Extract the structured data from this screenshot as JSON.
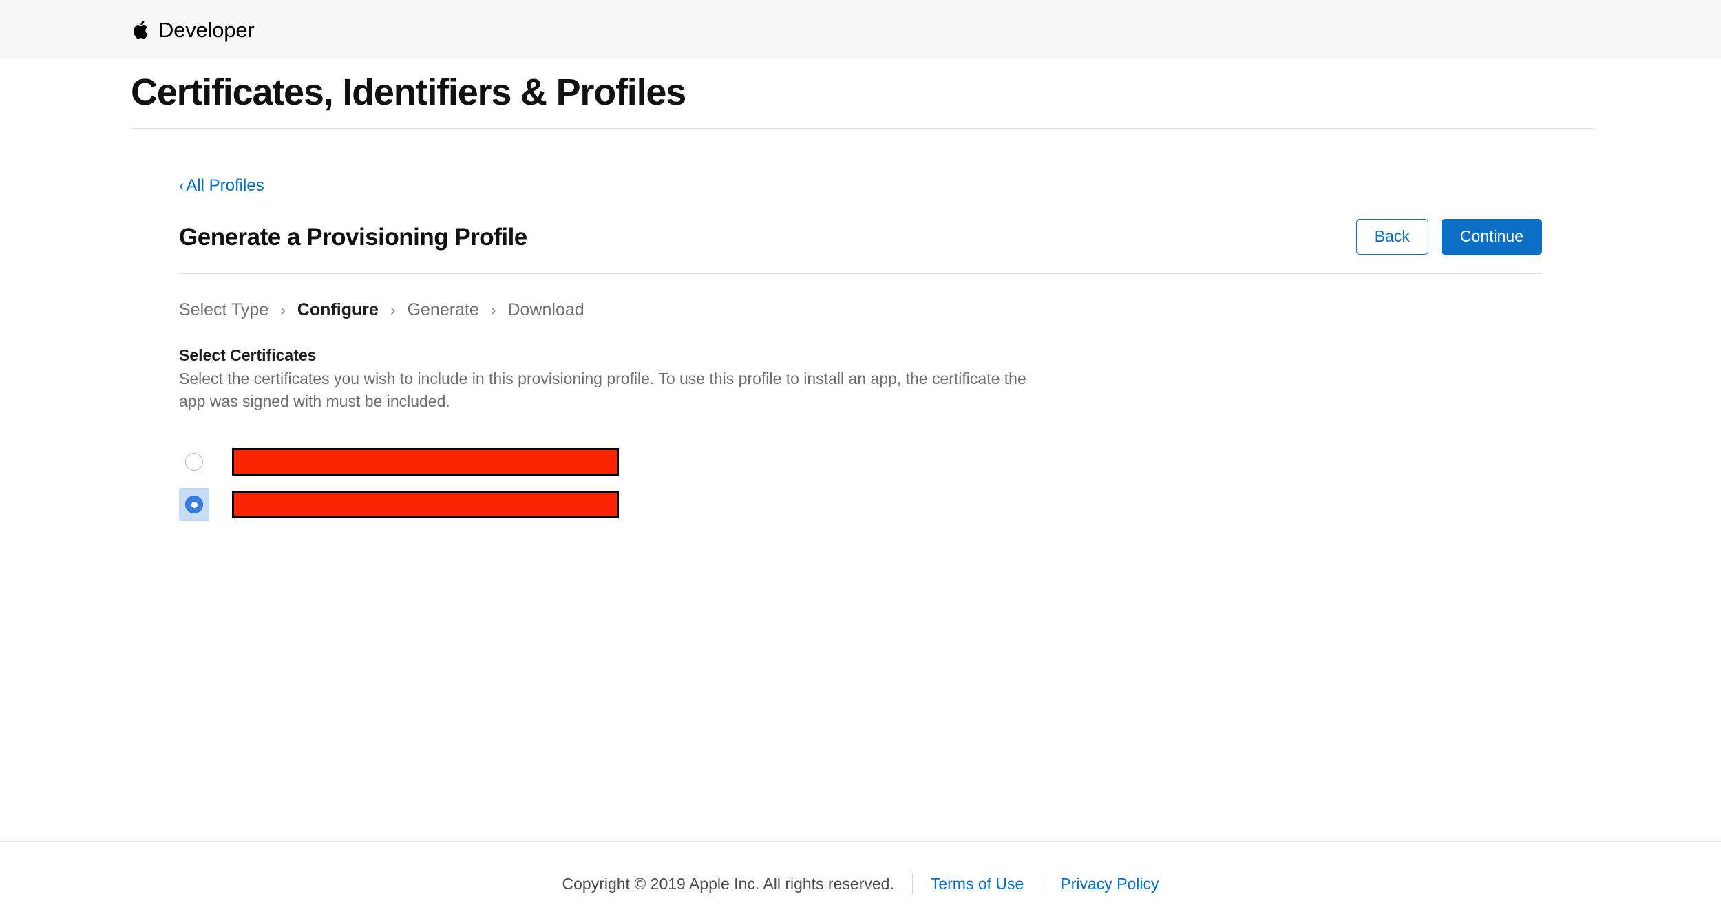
{
  "globalnav": {
    "logo_icon": "apple-logo-icon",
    "title": "Developer"
  },
  "page": {
    "title": "Certificates, Identifiers & Profiles"
  },
  "breadcrumb": {
    "chevron": "‹",
    "label": "All Profiles"
  },
  "section": {
    "title": "Generate a Provisioning Profile",
    "back_label": "Back",
    "continue_label": "Continue"
  },
  "steps": {
    "separator": "›",
    "items": [
      {
        "label": "Select Type",
        "active": false
      },
      {
        "label": "Configure",
        "active": true
      },
      {
        "label": "Generate",
        "active": false
      },
      {
        "label": "Download",
        "active": false
      }
    ]
  },
  "certificates": {
    "heading": "Select Certificates",
    "description": "Select the certificates you wish to include in this provisioning profile. To use this profile to install an app, the certificate the app was signed with must be included.",
    "rows": [
      {
        "selected": false,
        "focused": false,
        "label": ""
      },
      {
        "selected": true,
        "focused": true,
        "label": ""
      }
    ]
  },
  "footer": {
    "copyright": "Copyright © 2019 Apple Inc. All rights reserved.",
    "terms_label": "Terms of Use",
    "privacy_label": "Privacy Policy"
  },
  "colors": {
    "accent_blue": "#0070c9",
    "primary_button": "#0d6fc4",
    "redaction_red": "#fa2400",
    "focus_highlight": "#c6dcf7"
  }
}
